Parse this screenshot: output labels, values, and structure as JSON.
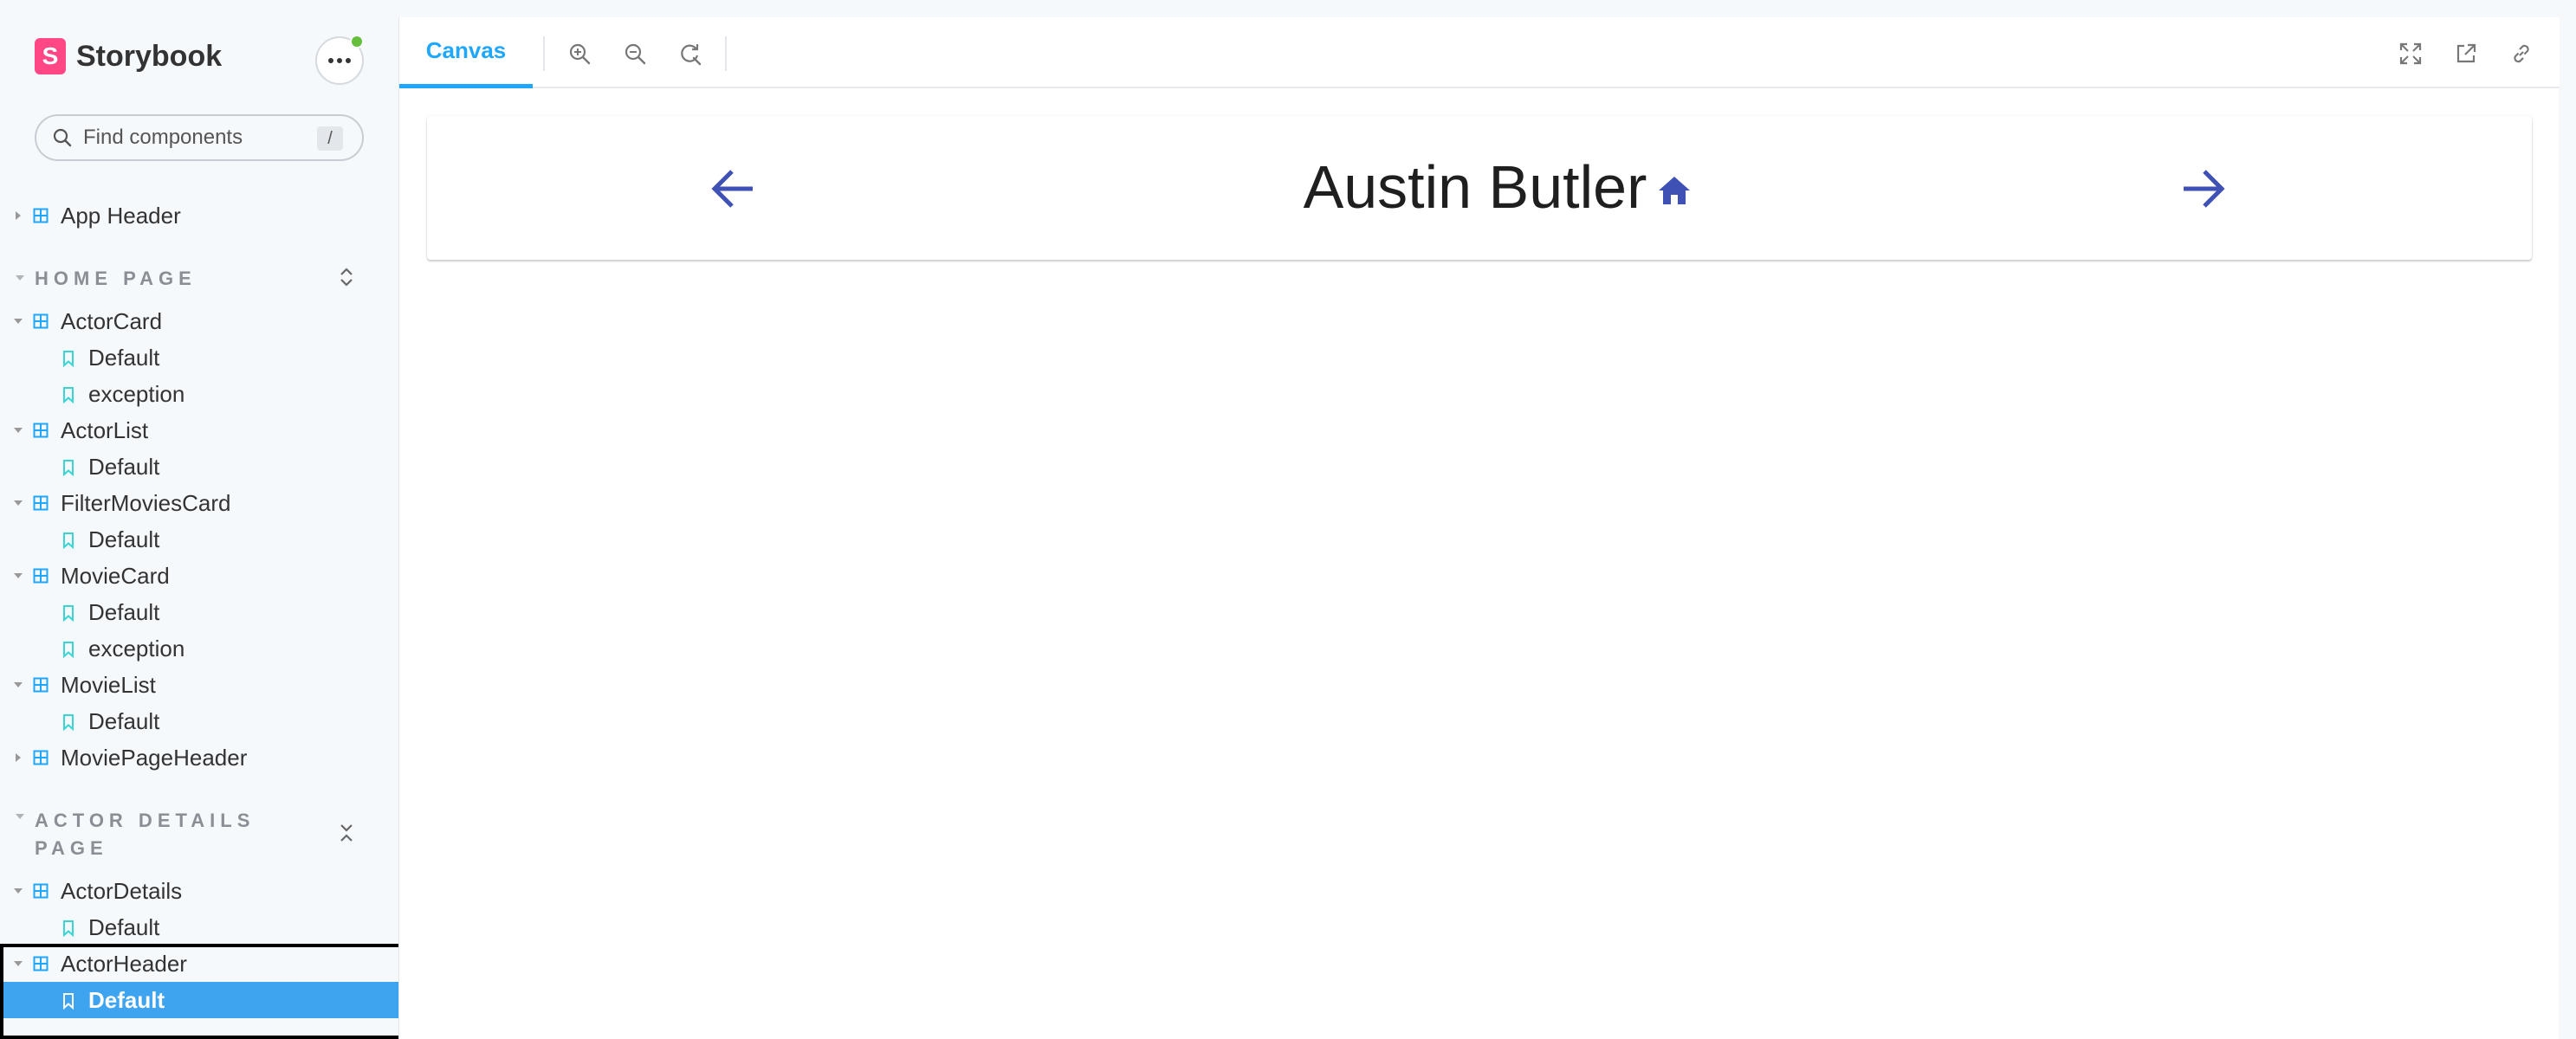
{
  "brand": {
    "logo_letter": "S",
    "name": "Storybook",
    "accent": "#ff4785"
  },
  "search": {
    "placeholder": "Find components",
    "shortcut": "/"
  },
  "sidebar": {
    "top_items": [
      {
        "label": "App Header"
      }
    ],
    "sections": [
      {
        "title": "HOME PAGE",
        "components": [
          {
            "label": "ActorCard",
            "stories": [
              "Default",
              "exception"
            ]
          },
          {
            "label": "ActorList",
            "stories": [
              "Default"
            ]
          },
          {
            "label": "FilterMoviesCard",
            "stories": [
              "Default"
            ]
          },
          {
            "label": "MovieCard",
            "stories": [
              "Default",
              "exception"
            ]
          },
          {
            "label": "MovieList",
            "stories": [
              "Default"
            ]
          },
          {
            "label": "MoviePageHeader",
            "stories": []
          }
        ]
      },
      {
        "title": "ACTOR DETAILS PAGE",
        "components": [
          {
            "label": "ActorDetails",
            "stories": [
              "Default"
            ]
          },
          {
            "label": "ActorHeader",
            "stories": [
              "Default"
            ]
          }
        ]
      }
    ],
    "selected_color": "#3fa4f0"
  },
  "toolbar": {
    "tab_label": "Canvas",
    "icons": [
      "zoom-in-icon",
      "zoom-out-icon",
      "reset-zoom-icon",
      "fullscreen-icon",
      "open-new-tab-icon",
      "copy-link-icon"
    ]
  },
  "preview": {
    "actor_name": "Austin Butler",
    "icon_color": "#3f51b5",
    "icons": [
      "arrow-back-icon",
      "home-icon",
      "arrow-forward-icon"
    ]
  }
}
